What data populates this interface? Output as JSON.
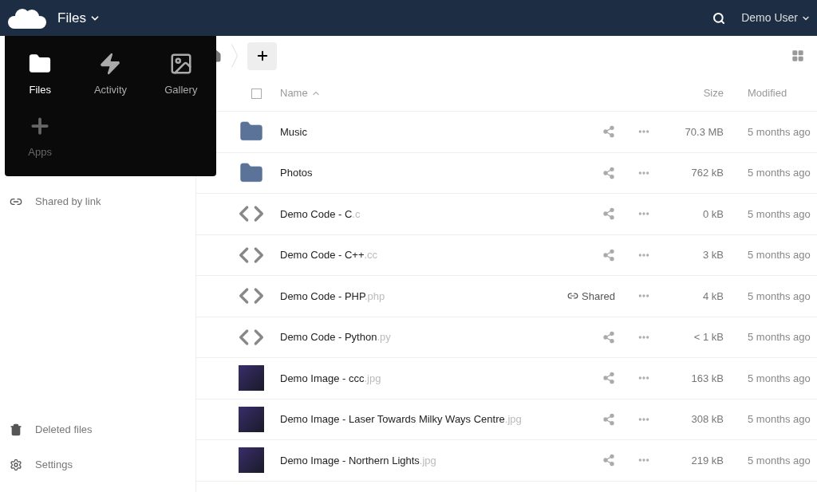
{
  "header": {
    "app_title": "Files",
    "user": "Demo User"
  },
  "app_menu": [
    {
      "label": "Files",
      "kind": "folder",
      "selected": true
    },
    {
      "label": "Activity",
      "kind": "bolt",
      "selected": false
    },
    {
      "label": "Gallery",
      "kind": "image",
      "selected": false
    },
    {
      "label": "Apps",
      "kind": "plus",
      "selected": false
    }
  ],
  "sidebar": {
    "items": [
      {
        "label": "Shared by link",
        "kind": "link"
      }
    ],
    "bottom_items": [
      {
        "label": "Deleted files",
        "kind": "trash"
      },
      {
        "label": "Settings",
        "kind": "gear"
      }
    ]
  },
  "table": {
    "select_all": {
      "checked": false
    },
    "columns": {
      "name": "Name",
      "size": "Size",
      "modified": "Modified"
    },
    "rows": [
      {
        "kind": "folder",
        "name": "Music",
        "ext": "",
        "size": "70.3 MB",
        "modified": "5 months ago",
        "shared": false
      },
      {
        "kind": "folder",
        "name": "Photos",
        "ext": "",
        "size": "762 kB",
        "modified": "5 months ago",
        "shared": false
      },
      {
        "kind": "code",
        "name": "Demo Code - C",
        "ext": ".c",
        "size": "0 kB",
        "modified": "5 months ago",
        "shared": false
      },
      {
        "kind": "code",
        "name": "Demo Code - C++",
        "ext": ".cc",
        "size": "3 kB",
        "modified": "5 months ago",
        "shared": false
      },
      {
        "kind": "code",
        "name": "Demo Code - PHP",
        "ext": ".php",
        "size": "4 kB",
        "modified": "5 months ago",
        "shared": true,
        "share_label": "Shared"
      },
      {
        "kind": "code",
        "name": "Demo Code - Python",
        "ext": ".py",
        "size": "< 1 kB",
        "modified": "5 months ago",
        "shared": false
      },
      {
        "kind": "image",
        "name": "Demo Image - ccc",
        "ext": ".jpg",
        "size": "163 kB",
        "modified": "5 months ago",
        "shared": false
      },
      {
        "kind": "image",
        "name": "Demo Image - Laser Towards Milky Ways Centre",
        "ext": ".jpg",
        "size": "308 kB",
        "modified": "5 months ago",
        "shared": false
      },
      {
        "kind": "image",
        "name": "Demo Image - Northern Lights",
        "ext": ".jpg",
        "size": "219 kB",
        "modified": "5 months ago",
        "shared": false
      }
    ]
  }
}
